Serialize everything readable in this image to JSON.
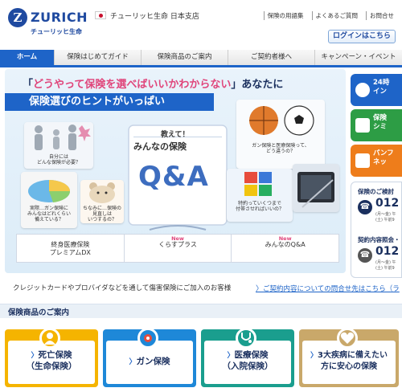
{
  "header": {
    "logo_letter": "Z",
    "logo_word": "ZURICH",
    "logo_sub": "チューリッヒ生命",
    "branch": "チューリッヒ生命 日本支店",
    "links": [
      "保険の用語集",
      "よくあるご質問",
      "お問合せ"
    ],
    "login": "ログインはこちら"
  },
  "nav": {
    "items": [
      "ホーム",
      "保険はじめてガイド",
      "保険商品のご案内",
      "ご契約者様へ",
      "キャンペーン・イベント"
    ]
  },
  "hero": {
    "headline_open": "「",
    "headline_quote": "どうやって保険を選べばいいかわからない",
    "headline_close": "」あなたに",
    "band": "保険選びのヒントがいっぱい",
    "qa_title1": "教えて！",
    "qa_title2": "みんなの保険",
    "qa_big": "Q&A",
    "tile1": "自分には\nどんな保険が必要？",
    "tile2": "ガン保険と医療保険って、\nどう違うの？",
    "tile3": "実際…ガン保険に\nみんなはどれくらい\n備えている？",
    "tile4": "ちなみに…保険の\n見直しは\nいつするの？",
    "tile5": "特約っていくつまで\n付帯させればいいの？",
    "links": [
      {
        "new": "",
        "line1": "終身医療保険",
        "line2": "プレミアムDX"
      },
      {
        "new": "New",
        "line1": "くらすプラス",
        "line2": ""
      },
      {
        "new": "New",
        "line1": "みんなのQ&A",
        "line2": ""
      }
    ]
  },
  "side": {
    "btn1": "24時\nイン",
    "btn2": "保険\nシミ",
    "btn3": "パンフ\nネッ",
    "contact1_label": "保険のご検討",
    "contact1_num": "012",
    "contact1_hours1": "(月〜金) 午",
    "contact1_hours2": "(土) 午前9",
    "contact2_label": "契約内容照会・",
    "contact2_num": "012",
    "contact2_hours1": "(月〜金) 午",
    "contact2_hours2": "(土) 午前9"
  },
  "notice": {
    "text": "クレジットカードやプロバイダなどを通して傷害保険にご加入のお客様",
    "link": "ご契約内容についての問合せ先はこちら（ラ"
  },
  "section": {
    "title": "保険商品のご案内",
    "cards": [
      {
        "line1": "死亡保険",
        "line2": "（生命保険）",
        "color": "#f5b400",
        "icon": "person-icon"
      },
      {
        "line1": "ガン保険",
        "line2": "",
        "color": "#1e88d8",
        "icon": "cancer-icon"
      },
      {
        "line1": "医療保険",
        "line2": "（入院保険）",
        "color": "#1a9e8e",
        "icon": "stethoscope-icon"
      },
      {
        "line1": "3大疾病に備えたい",
        "line2": "方に安心の保険",
        "color": "#c9a86a",
        "icon": "heart-icon"
      }
    ]
  },
  "colors": {
    "brand": "#1f4aa0",
    "nav_active": "#1e64c8",
    "accent_pink": "#e0457b"
  }
}
